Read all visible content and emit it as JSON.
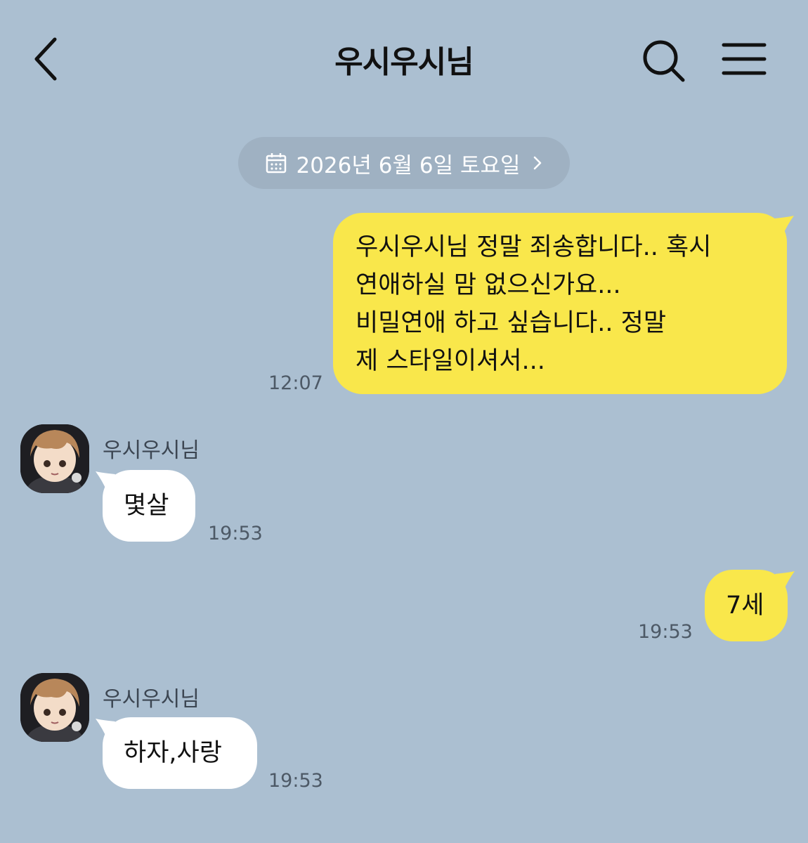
{
  "header": {
    "title": "우시우시님"
  },
  "date_divider": {
    "label": "2026년 6월 6일 토요일"
  },
  "messages": [
    {
      "side": "sent",
      "lines": [
        "우시우시님 정말 죄송합니다.. 혹시",
        "연애하실 맘 없으신가요...",
        "비밀연애 하고 싶습니다.. 정말",
        "제 스타일이셔서..."
      ],
      "time": "12:07"
    },
    {
      "side": "received",
      "sender": "우시우시님",
      "text": "몇살",
      "time": "19:53"
    },
    {
      "side": "sent",
      "text": "7세",
      "time": "19:53"
    },
    {
      "side": "received",
      "sender": "우시우시님",
      "text": "하자,사랑",
      "time": "19:53"
    }
  ],
  "colors": {
    "background": "#abbfd1",
    "sent_bubble": "#f9e74b",
    "received_bubble": "#ffffff",
    "date_pill": "#9fb1c2"
  }
}
